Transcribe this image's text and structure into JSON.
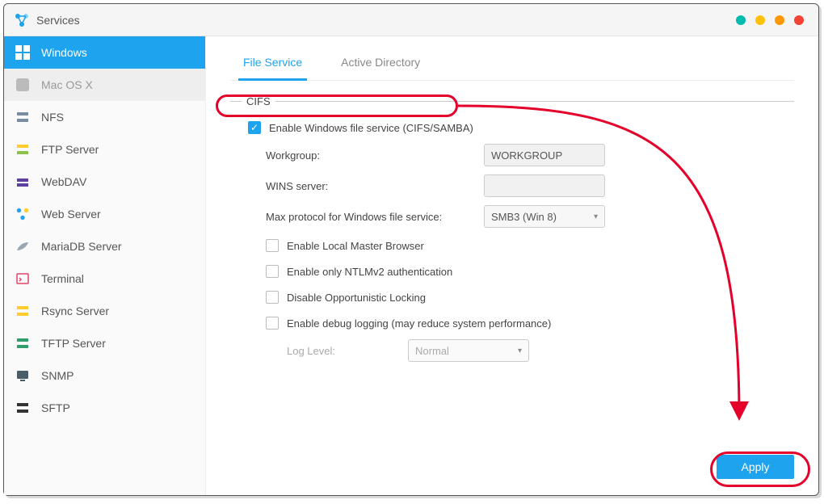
{
  "window": {
    "title": "Services"
  },
  "sidebar": {
    "items": [
      {
        "label": "Windows"
      },
      {
        "label": "Mac OS X"
      },
      {
        "label": "NFS"
      },
      {
        "label": "FTP Server"
      },
      {
        "label": "WebDAV"
      },
      {
        "label": "Web Server"
      },
      {
        "label": "MariaDB Server"
      },
      {
        "label": "Terminal"
      },
      {
        "label": "Rsync Server"
      },
      {
        "label": "TFTP Server"
      },
      {
        "label": "SNMP"
      },
      {
        "label": "SFTP"
      }
    ]
  },
  "tabs": {
    "file_service": "File Service",
    "active_directory": "Active Directory"
  },
  "section": {
    "cifs_title": "CIFS"
  },
  "cifs": {
    "enable_label": "Enable Windows file service (CIFS/SAMBA)",
    "workgroup_label": "Workgroup:",
    "workgroup_value": "WORKGROUP",
    "wins_label": "WINS server:",
    "wins_value": "",
    "maxproto_label": "Max protocol for Windows file service:",
    "maxproto_value": "SMB3 (Win 8)",
    "lmb_label": "Enable Local Master Browser",
    "ntlm_label": "Enable only NTLMv2 authentication",
    "oplock_label": "Disable Opportunistic Locking",
    "debug_label": "Enable debug logging (may reduce system performance)",
    "loglevel_label": "Log Level:",
    "loglevel_value": "Normal"
  },
  "buttons": {
    "apply": "Apply"
  }
}
